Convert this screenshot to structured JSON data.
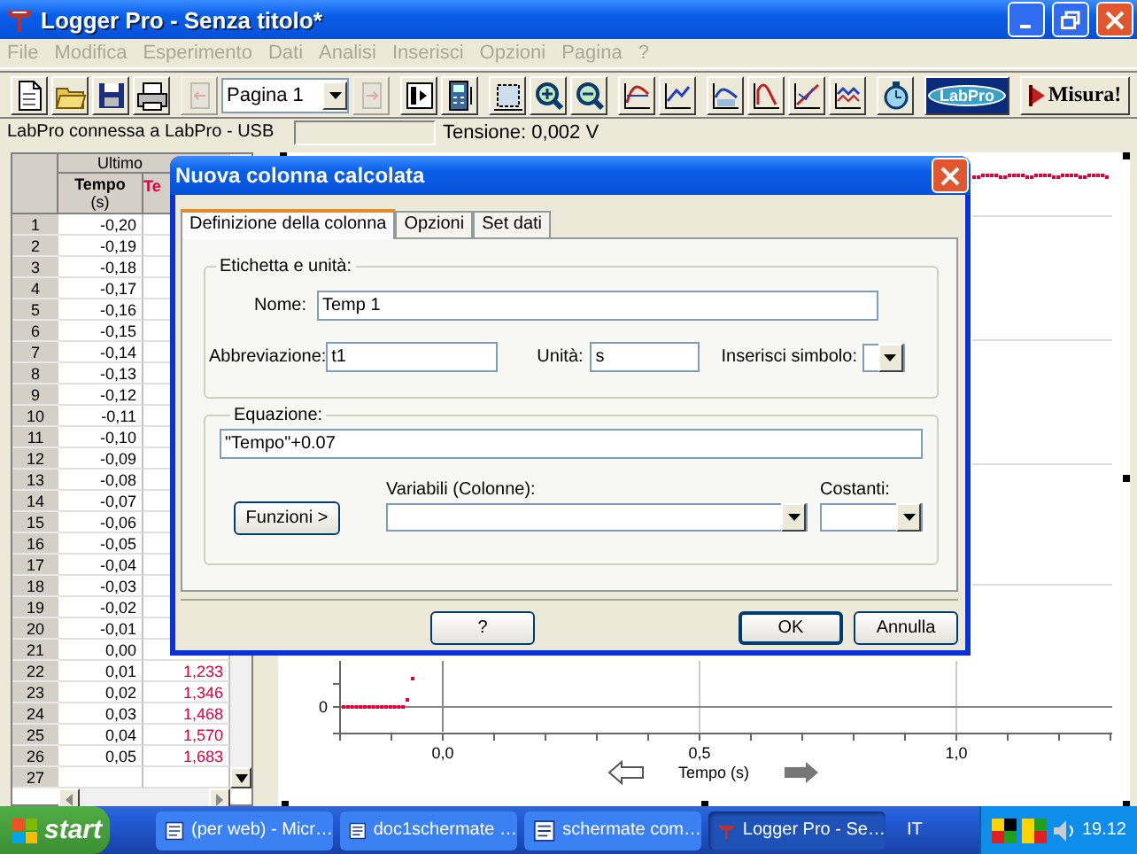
{
  "window": {
    "title": "Logger Pro - Senza titolo*"
  },
  "menu": [
    {
      "label": "File",
      "disabled": true
    },
    {
      "label": "Modifica",
      "disabled": true
    },
    {
      "label": "Esperimento",
      "disabled": true
    },
    {
      "label": "Dati",
      "disabled": true
    },
    {
      "label": "Analisi",
      "disabled": true
    },
    {
      "label": "Inserisci",
      "disabled": true
    },
    {
      "label": "Opzioni",
      "disabled": true
    },
    {
      "label": "Pagina",
      "disabled": true
    },
    {
      "label": "?",
      "disabled": true
    }
  ],
  "toolbar": [
    [
      {
        "kind": "icon",
        "disabled": false
      },
      {
        "kind": "icon",
        "disabled": false
      },
      {
        "kind": "icon",
        "disabled": false
      },
      {
        "kind": "icon",
        "disabled": false
      }
    ],
    [
      {
        "kind": "icon",
        "disabled": true
      },
      {
        "kind": "dropdown",
        "value": "Pagina 1"
      },
      {
        "kind": "icon",
        "disabled": true
      }
    ],
    [
      {
        "kind": "icon",
        "disabled": false
      },
      {
        "kind": "icon",
        "disabled": false
      }
    ],
    [
      {
        "kind": "icon",
        "disabled": false
      },
      {
        "kind": "icon",
        "disabled": false
      },
      {
        "kind": "icon",
        "disabled": false
      }
    ],
    [
      {
        "kind": "icon",
        "disabled": false
      },
      {
        "kind": "icon",
        "disabled": false
      }
    ],
    [
      {
        "kind": "icon",
        "disabled": false
      },
      {
        "kind": "icon",
        "disabled": false
      },
      {
        "kind": "icon",
        "disabled": false
      },
      {
        "kind": "icon",
        "disabled": false
      }
    ],
    [
      {
        "kind": "icon",
        "disabled": false
      }
    ],
    [
      {
        "kind": "badge",
        "label": "LabPro"
      }
    ],
    [
      {
        "kind": "start",
        "label": "Misura!"
      }
    ]
  ],
  "status": {
    "connection": "LabPro connessa a LabPro - USB",
    "reading": "Tensione: 0,002 V"
  },
  "table": {
    "group_header": "Ultimo",
    "columns": [
      {
        "name": "Tempo",
        "unit": "(s)",
        "color": "#000000"
      },
      {
        "name": "Te",
        "color": "#e0003c"
      }
    ],
    "rows": [
      {
        "index": "1",
        "column_1": "-0,20"
      },
      {
        "index": "2",
        "column_1": "-0,19"
      },
      {
        "index": "3",
        "column_1": "-0,18"
      },
      {
        "index": "4",
        "column_1": "-0,17"
      },
      {
        "index": "5",
        "column_1": "-0,16"
      },
      {
        "index": "6",
        "column_1": "-0,15"
      },
      {
        "index": "7",
        "column_1": "-0,14"
      },
      {
        "index": "8",
        "column_1": "-0,13"
      },
      {
        "index": "9",
        "column_1": "-0,12"
      },
      {
        "index": "10",
        "column_1": "-0,11"
      },
      {
        "index": "11",
        "column_1": "-0,10"
      },
      {
        "index": "12",
        "column_1": "-0,09"
      },
      {
        "index": "13",
        "column_1": "-0,08"
      },
      {
        "index": "14",
        "column_1": "-0,07"
      },
      {
        "index": "15",
        "column_1": "-0,06"
      },
      {
        "index": "16",
        "column_1": "-0,05"
      },
      {
        "index": "17",
        "column_1": "-0,04"
      },
      {
        "index": "18",
        "column_1": "-0,03"
      },
      {
        "index": "19",
        "column_1": "-0,02"
      },
      {
        "index": "20",
        "column_1": "-0,01"
      },
      {
        "index": "21",
        "column_1": "0,00"
      },
      {
        "index": "22",
        "column_1": "0,01",
        "column_2": "1,233"
      },
      {
        "index": "23",
        "column_1": "0,02",
        "column_2": "1,346"
      },
      {
        "index": "24",
        "column_1": "0,03",
        "column_2": "1,468"
      },
      {
        "index": "25",
        "column_1": "0,04",
        "column_2": "1,570"
      },
      {
        "index": "26",
        "column_1": "0,05",
        "column_2": "1,683"
      },
      {
        "index": "27"
      }
    ]
  },
  "graph": {
    "y_tick_labels": [
      "0"
    ],
    "x_tick_labels": [
      "0,0",
      "0,5",
      "1,0"
    ],
    "xlabel": "Tempo (s)"
  },
  "dialog": {
    "title": "Nuova colonna calcolata",
    "tabs": [
      {
        "label": "Definizione della colonna",
        "selected": true
      },
      {
        "label": "Opzioni",
        "selected": false
      },
      {
        "label": "Set dati",
        "selected": false
      }
    ],
    "label_group": {
      "title": "Etichetta e unità:",
      "name_label": "Nome:",
      "name_value": "Temp 1",
      "abbr_label": "Abbreviazione:",
      "abbr_value": "t1",
      "unit_label": "Unità:",
      "unit_value": "s",
      "symbol_label": "Inserisci simbolo:"
    },
    "equation_group": {
      "title": "Equazione:",
      "value": "\"Tempo\"+0.07",
      "functions_button": "Funzioni >",
      "variables_label": "Variabili (Colonne):",
      "constants_label": "Costanti:"
    },
    "buttons": [
      {
        "label": "?",
        "default": false
      },
      {
        "label": "OK",
        "default": true
      },
      {
        "label": "Annulla",
        "default": false
      }
    ]
  },
  "taskbar": {
    "start": "start",
    "tasks": [
      {
        "label": "(per web) - Micr…",
        "selected": false
      },
      {
        "label": "doc1schermate …",
        "selected": false
      },
      {
        "label": "schermate com…",
        "selected": false
      },
      {
        "label": "Logger Pro - Se…",
        "selected": true
      }
    ],
    "language": "IT",
    "clock": "19.12"
  }
}
